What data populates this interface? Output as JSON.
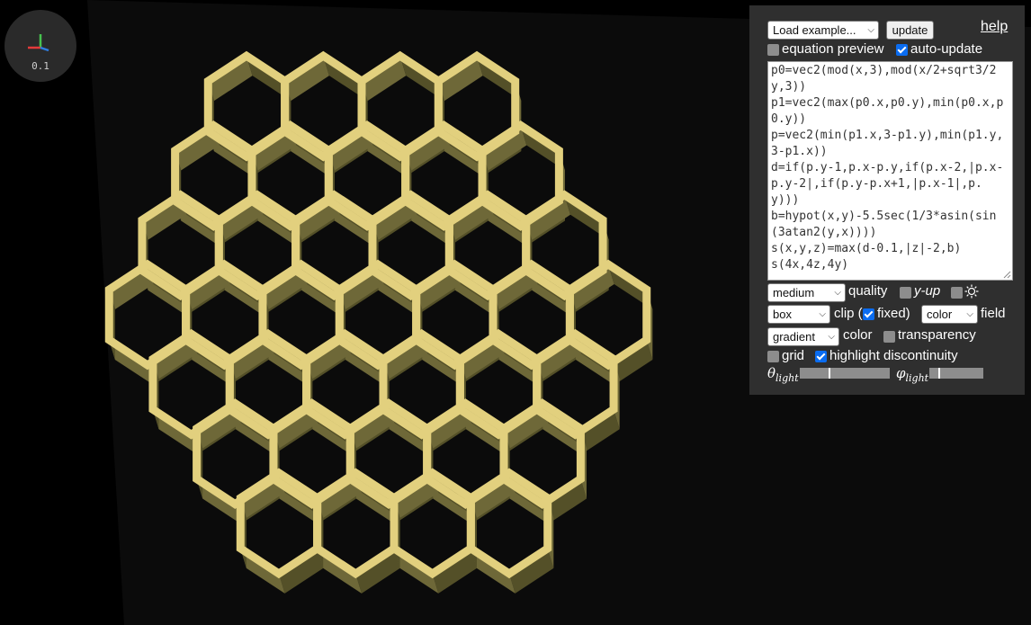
{
  "axis_widget": {
    "scale_label": "0.1",
    "colors": {
      "x": "#e33b3b",
      "y": "#2f7de0",
      "z": "#46c24e"
    }
  },
  "render": {
    "object": "honeycomb lattice",
    "face_color": "#e2d07e",
    "wall_color": "#6e6838",
    "background": "#0b0b0b"
  },
  "panel": {
    "load_example": "Load example...",
    "update_button": "update",
    "help_link": "help",
    "equation_preview": {
      "label": "equation preview",
      "checked": false
    },
    "auto_update": {
      "label": "auto-update",
      "checked": true
    },
    "equation_text": "p0=vec2(mod(x,3),mod(x/2+sqrt3/2y,3))\np1=vec2(max(p0.x,p0.y),min(p0.x,p0.y))\np=vec2(min(p1.x,3-p1.y),min(p1.y,3-p1.x))\nd=if(p.y-1,p.x-p.y,if(p.x-2,|p.x-p.y-2|,if(p.y-p.x+1,|p.x-1|,p.y)))\nb=hypot(x,y)-5.5sec(1/3*asin(sin(3atan2(y,x))))\ns(x,y,z)=max(d-0.1,|z|-2,b)\ns(4x,4z,4y)",
    "quality_select": "medium",
    "quality_label": "quality",
    "y_up": {
      "label": "y-up",
      "checked": false
    },
    "light_toggle": {
      "icon": "sun-icon",
      "checked": false
    },
    "clip_select": "box",
    "clip_label": "clip (",
    "fixed": {
      "label": "fixed)",
      "checked": true
    },
    "field_select": "color",
    "field_label": "field",
    "color_select": "gradient",
    "color_label": "color",
    "transparency": {
      "label": "transparency",
      "checked": false
    },
    "grid": {
      "label": "grid",
      "checked": false
    },
    "highlight_discontinuity": {
      "label": "highlight discontinuity",
      "checked": true
    },
    "theta_light": {
      "symbol": "θ",
      "sub": "light",
      "value": 0.33
    },
    "phi_light": {
      "symbol": "φ",
      "sub": "light",
      "value": 0.17
    }
  }
}
